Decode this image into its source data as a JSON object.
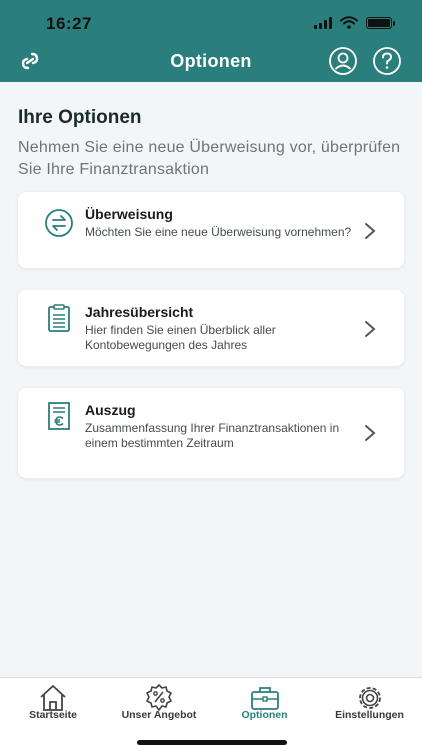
{
  "status": {
    "time": "16:27"
  },
  "header": {
    "title": "Optionen",
    "bg_color": "#2a7f7c"
  },
  "page": {
    "heading": "Ihre Optionen",
    "subtitle": "Nehmen Sie eine neue Überweisung vor, überprüfen Sie Ihre Finanztransaktion"
  },
  "options": [
    {
      "title": "Überweisung",
      "description": "Möchten Sie eine neue Überweisung vornehmen?",
      "icon": "transfer-icon"
    },
    {
      "title": "Jahresübersicht",
      "description": "Hier finden Sie einen Überblick aller Kontobewegungen des Jahres",
      "icon": "clipboard-icon"
    },
    {
      "title": "Auszug",
      "description": "Zusammenfassung Ihrer Finanztransaktionen in einem bestimmten Zeitraum",
      "icon": "statement-euro-icon"
    }
  ],
  "tabs": [
    {
      "label": "Startseite",
      "icon": "home-icon",
      "active": false
    },
    {
      "label": "Unser Angebot",
      "icon": "percent-badge-icon",
      "active": false
    },
    {
      "label": "Optionen",
      "icon": "briefcase-icon",
      "active": true
    },
    {
      "label": "Einstellungen",
      "icon": "gear-icon",
      "active": false
    }
  ],
  "colors": {
    "accent": "#2a7f7c",
    "background": "#f2f6f7"
  }
}
